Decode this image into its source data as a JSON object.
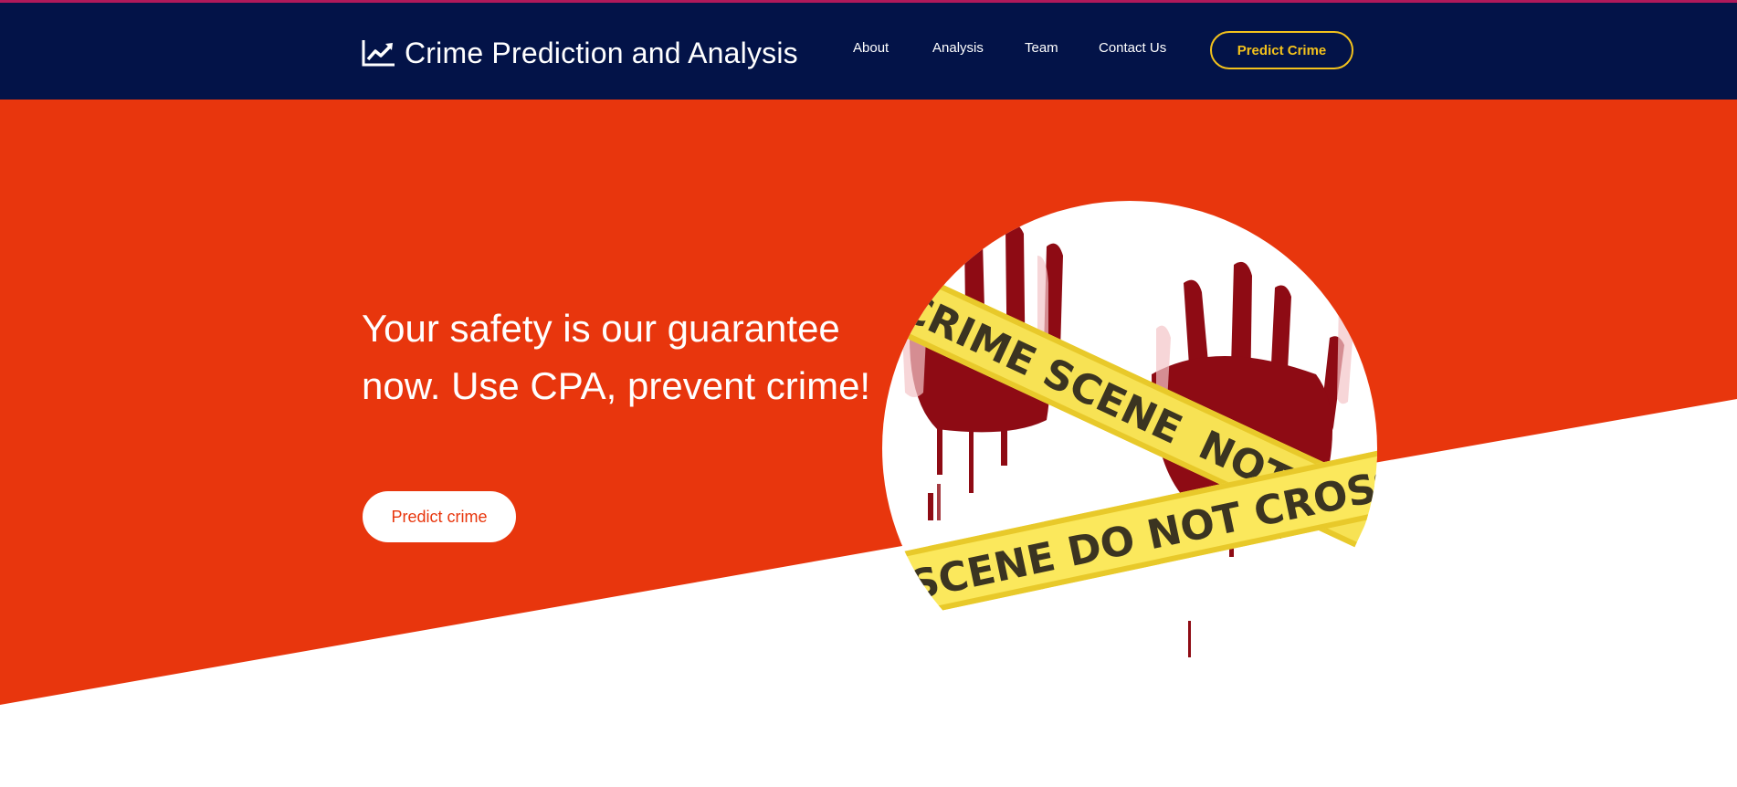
{
  "header": {
    "brand_title": "Crime Prediction and Analysis",
    "brand_icon": "chart-line-icon",
    "nav": [
      {
        "label": "About"
      },
      {
        "label": "Analysis"
      },
      {
        "label": "Team"
      },
      {
        "label": "Contact Us"
      }
    ],
    "cta_label": "Predict Crime"
  },
  "hero": {
    "headline": "Your safety is our guarantee now. Use CPA, prevent crime!",
    "button_label": "Predict crime",
    "image": {
      "tape_text_1": "CRIME SCENE",
      "tape_text_2": "SCENE DO NOT CROSS",
      "tape_text_3": "NOT C"
    }
  },
  "colors": {
    "navbar": "#031348",
    "accent_top": "#b0195a",
    "hero_red": "#e8360d",
    "cta_yellow": "#f3c21c",
    "tape_yellow": "#f7e254",
    "blood_red": "#8e0b14"
  }
}
